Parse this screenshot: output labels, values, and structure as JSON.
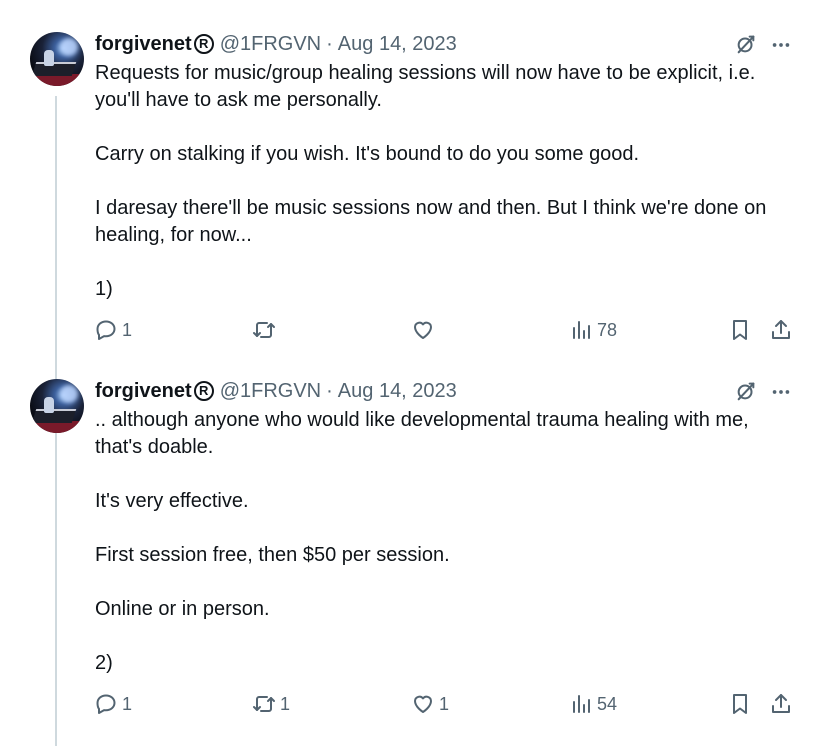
{
  "tweets": [
    {
      "author_name": "forgivenet",
      "verified_mark": "R",
      "handle": "@1FRGVN",
      "separator": "·",
      "date": "Aug 14, 2023",
      "paragraphs": [
        "Requests for music/group healing sessions will now have to be explicit, i.e. you'll have to ask me personally.",
        "Carry on stalking if you wish. It's bound to do you some good.",
        "I daresay there'll be music sessions now and then. But I think we're done on healing, for now...",
        "1)"
      ],
      "replies": "1",
      "reposts": "",
      "likes": "",
      "views": "78"
    },
    {
      "author_name": "forgivenet",
      "verified_mark": "R",
      "handle": "@1FRGVN",
      "separator": "·",
      "date": "Aug 14, 2023",
      "paragraphs": [
        ".. although anyone who would like developmental trauma healing with me, that's doable.",
        "It's very effective.",
        "First session free, then $50 per session.",
        "Online or in person.",
        "2)"
      ],
      "replies": "1",
      "reposts": "1",
      "likes": "1",
      "views": "54"
    }
  ],
  "colors": {
    "text": "#0f1419",
    "secondary": "#536471",
    "thread_line": "#cfd9de"
  },
  "icons": [
    "grok-icon",
    "more-icon",
    "reply-icon",
    "repost-icon",
    "like-icon",
    "views-icon",
    "bookmark-icon",
    "share-icon"
  ]
}
